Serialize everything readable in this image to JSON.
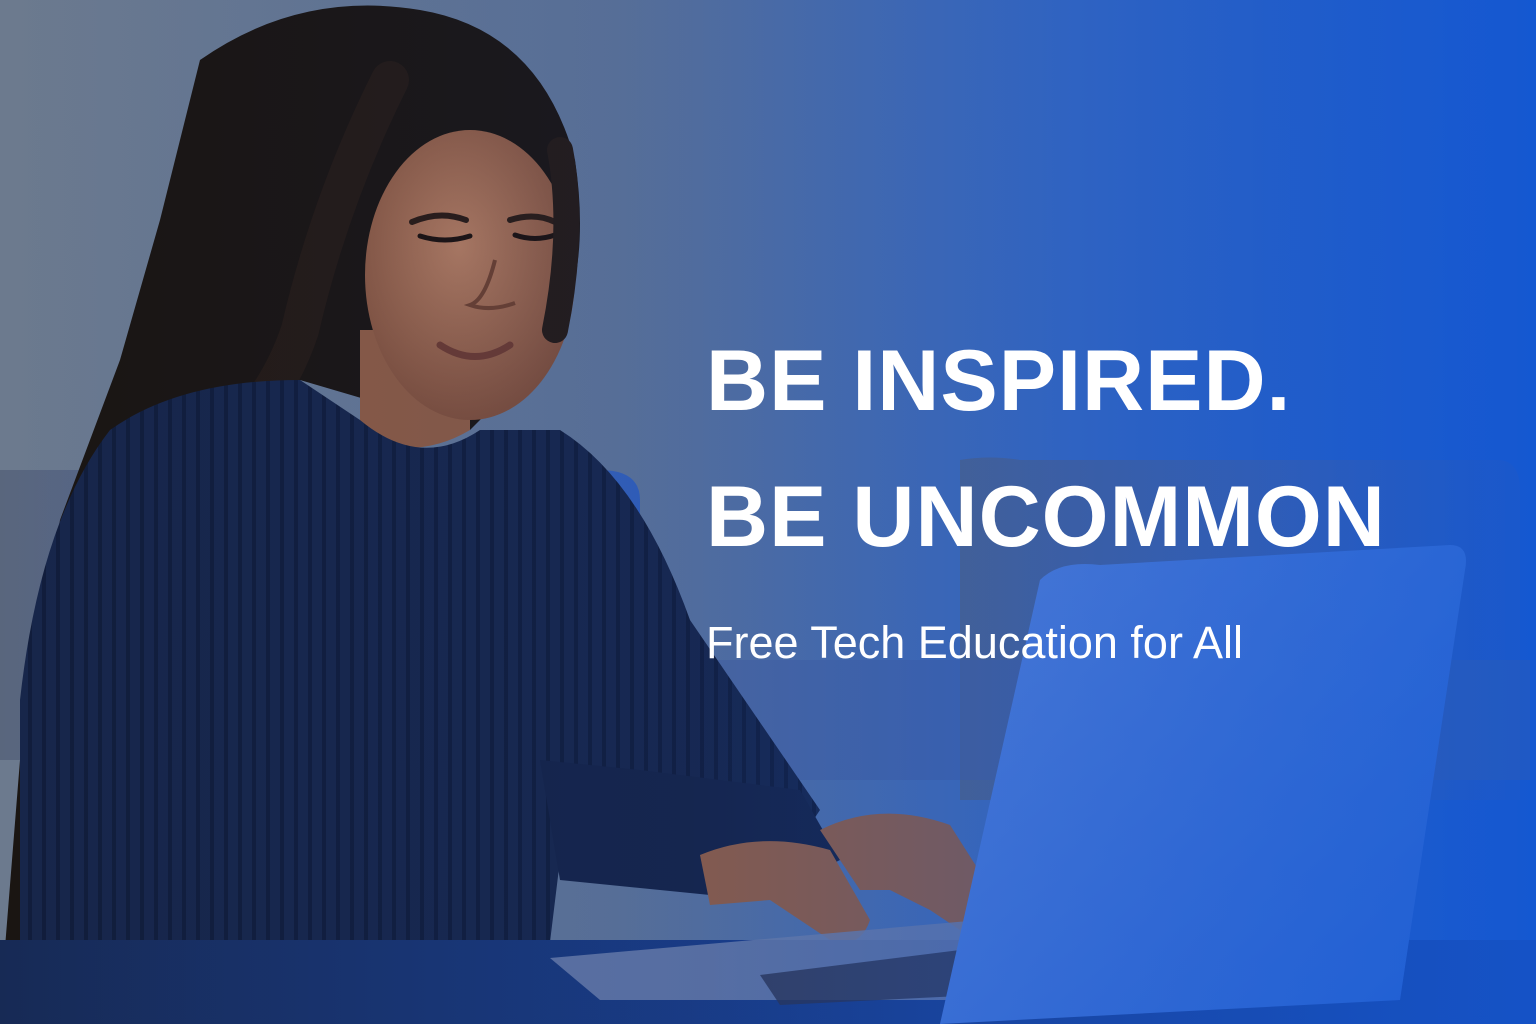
{
  "hero": {
    "headline_line1": "BE INSPIRED.",
    "headline_line2": "BE UNCOMMON",
    "tagline": "Free Tech Education for All"
  },
  "colors": {
    "text": "#ffffff",
    "accent_blue": "#1f5fd0",
    "sweater_navy": "#17264a",
    "wall_gray_blue": "#6b7d94"
  }
}
